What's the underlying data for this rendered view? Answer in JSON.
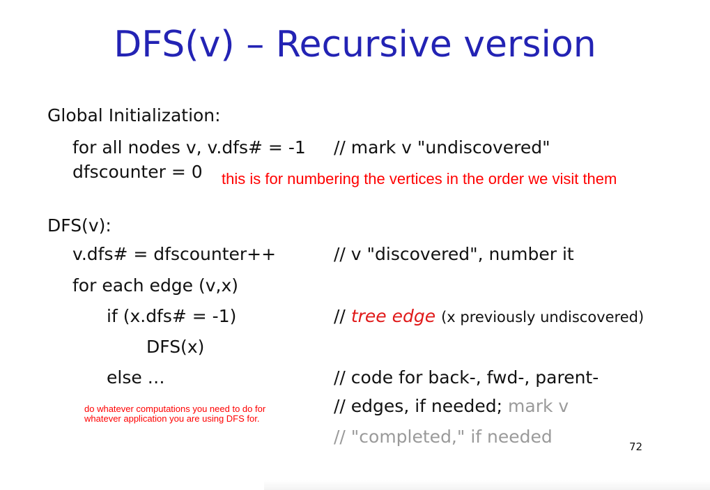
{
  "slide": {
    "title": "DFS(v) – Recursive version",
    "global_init": "Global Initialization:",
    "init_line1_code": "for all nodes v, v.dfs# = -1",
    "init_line1_comment": "// mark v \"undiscovered\"",
    "init_line2_code": "dfscounter = 0",
    "note_numbering": "this is for numbering the vertices in the order we visit them",
    "dfs_header": "DFS(v):",
    "body_line1_code": "v.dfs# = dfscounter++",
    "body_line1_comment": "// v \"discovered\", number it",
    "body_line2_code": "for each edge (v,x)",
    "body_line3_code": "if (x.dfs# = -1)",
    "body_line3_comment_prefix": "//",
    "body_line3_comment_em": "tree edge",
    "body_line3_comment_paren": "(x previously  undiscovered)",
    "body_line4_code": "DFS(x)",
    "body_line5_code": "else …",
    "body_line5_comment": "// code for back-, fwd-, parent-",
    "body_line6_comment_prefix": "// edges, if needed;",
    "body_line6_comment_gray": "mark v",
    "body_line7_comment_gray": "// \"completed,\" if needed",
    "note_computations": "do whatever computations you need to do for whatever application you are using DFS for.",
    "page_number": "72"
  },
  "colors": {
    "title": "#2323b4",
    "annotation": "#ff0000",
    "emphasis": "#e01818",
    "faded": "#9a9a9a"
  }
}
